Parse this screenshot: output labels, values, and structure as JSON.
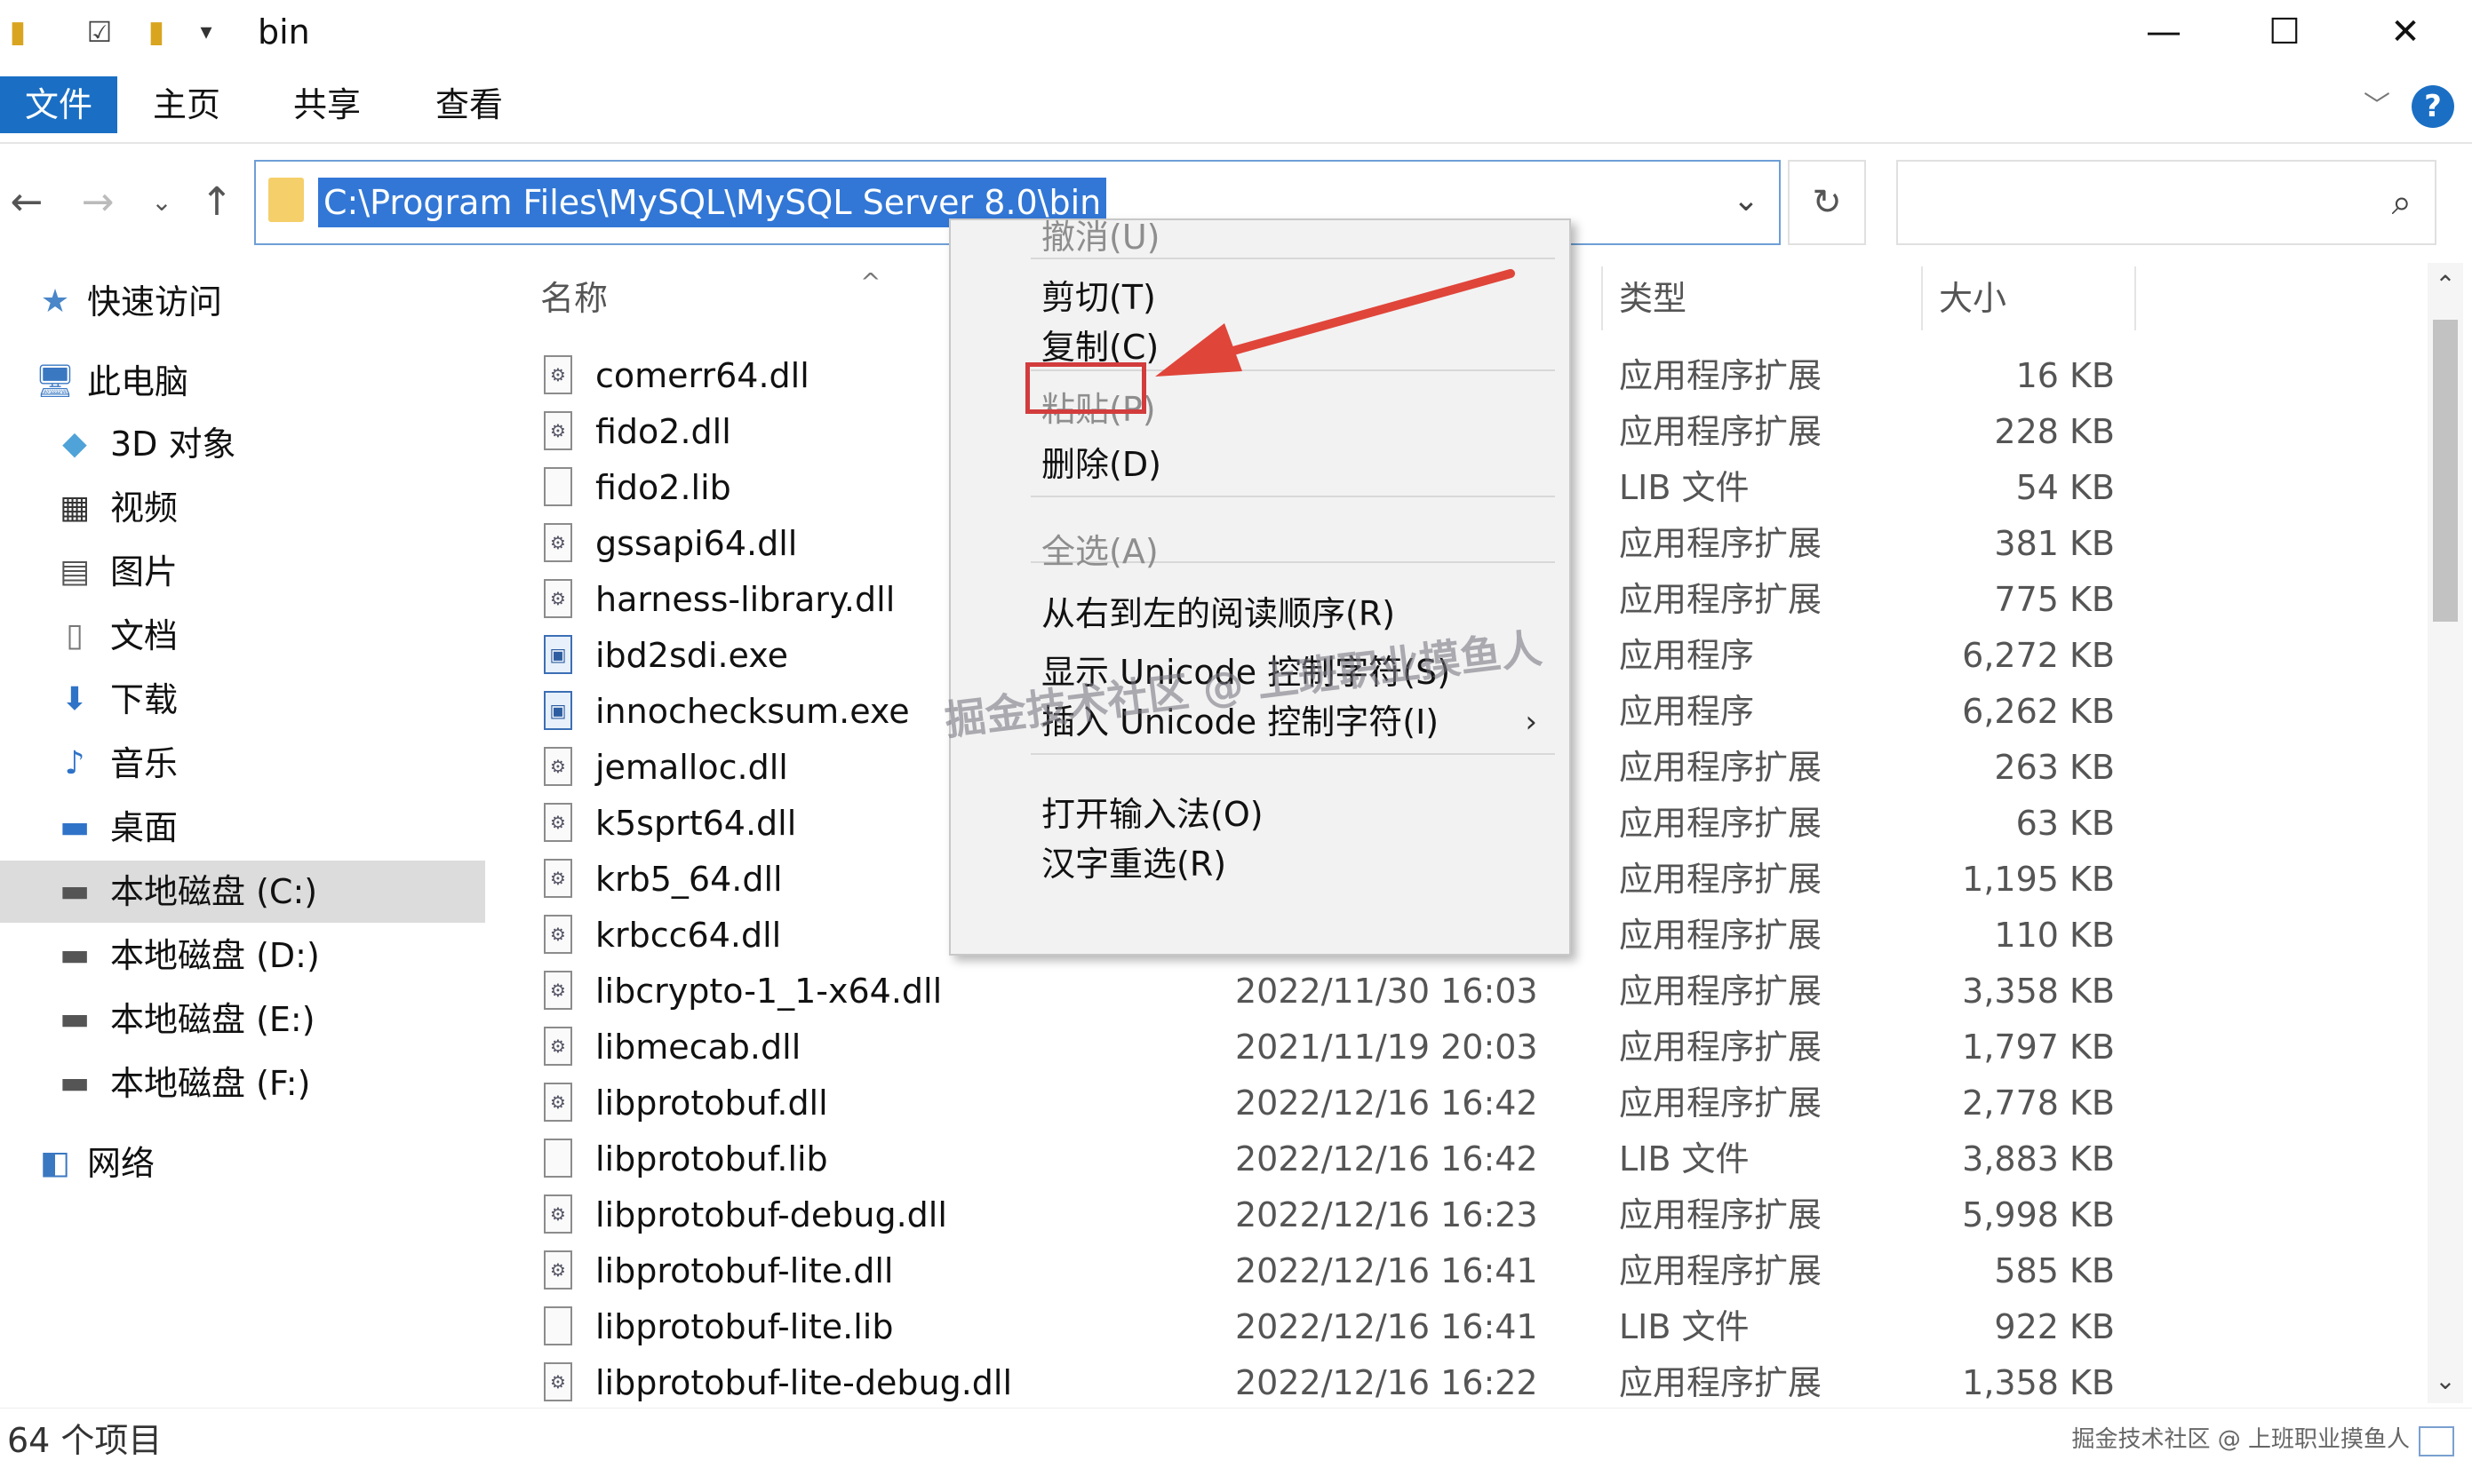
{
  "window": {
    "title": "bin",
    "minimize": "—",
    "maximize": "☐",
    "close": "✕"
  },
  "ribbon": {
    "tabs": [
      "文件",
      "主页",
      "共享",
      "查看"
    ],
    "help": "?"
  },
  "address": {
    "path": "C:\\Program Files\\MySQL\\MySQL Server 8.0\\bin"
  },
  "nav_pane": {
    "items": [
      {
        "label": "快速访问",
        "icon": "star-icon"
      },
      {
        "label": "此电脑",
        "icon": "computer-icon"
      },
      {
        "label": "3D 对象",
        "icon": "cube-icon"
      },
      {
        "label": "视频",
        "icon": "film-icon"
      },
      {
        "label": "图片",
        "icon": "picture-icon"
      },
      {
        "label": "文档",
        "icon": "document-icon"
      },
      {
        "label": "下载",
        "icon": "download-icon"
      },
      {
        "label": "音乐",
        "icon": "music-icon"
      },
      {
        "label": "桌面",
        "icon": "desktop-icon"
      },
      {
        "label": "本地磁盘 (C:)",
        "icon": "drive-icon",
        "selected": true
      },
      {
        "label": "本地磁盘 (D:)",
        "icon": "drive-icon"
      },
      {
        "label": "本地磁盘 (E:)",
        "icon": "drive-icon"
      },
      {
        "label": "本地磁盘 (F:)",
        "icon": "drive-icon"
      },
      {
        "label": "网络",
        "icon": "network-icon"
      }
    ]
  },
  "file_list": {
    "columns": {
      "name": "名称",
      "type": "类型",
      "size": "大小"
    },
    "rows": [
      {
        "name": "comerr64.dll",
        "date": "",
        "type": "应用程序扩展",
        "size": "16 KB",
        "kind": "dll"
      },
      {
        "name": "fido2.dll",
        "date": "",
        "type": "应用程序扩展",
        "size": "228 KB",
        "kind": "dll"
      },
      {
        "name": "fido2.lib",
        "date": "",
        "type": "LIB 文件",
        "size": "54 KB",
        "kind": "lib"
      },
      {
        "name": "gssapi64.dll",
        "date": "",
        "type": "应用程序扩展",
        "size": "381 KB",
        "kind": "dll"
      },
      {
        "name": "harness-library.dll",
        "date": "",
        "type": "应用程序扩展",
        "size": "775 KB",
        "kind": "dll"
      },
      {
        "name": "ibd2sdi.exe",
        "date": "",
        "type": "应用程序",
        "size": "6,272 KB",
        "kind": "exe"
      },
      {
        "name": "innochecksum.exe",
        "date": "",
        "type": "应用程序",
        "size": "6,262 KB",
        "kind": "exe"
      },
      {
        "name": "jemalloc.dll",
        "date": "",
        "type": "应用程序扩展",
        "size": "263 KB",
        "kind": "dll"
      },
      {
        "name": "k5sprt64.dll",
        "date": "",
        "type": "应用程序扩展",
        "size": "63 KB",
        "kind": "dll"
      },
      {
        "name": "krb5_64.dll",
        "date": "",
        "type": "应用程序扩展",
        "size": "1,195 KB",
        "kind": "dll"
      },
      {
        "name": "krbcc64.dll",
        "date": "",
        "type": "应用程序扩展",
        "size": "110 KB",
        "kind": "dll"
      },
      {
        "name": "libcrypto-1_1-x64.dll",
        "date": "2022/11/30 16:03",
        "type": "应用程序扩展",
        "size": "3,358 KB",
        "kind": "dll"
      },
      {
        "name": "libmecab.dll",
        "date": "2021/11/19 20:03",
        "type": "应用程序扩展",
        "size": "1,797 KB",
        "kind": "dll"
      },
      {
        "name": "libprotobuf.dll",
        "date": "2022/12/16 16:42",
        "type": "应用程序扩展",
        "size": "2,778 KB",
        "kind": "dll"
      },
      {
        "name": "libprotobuf.lib",
        "date": "2022/12/16 16:42",
        "type": "LIB 文件",
        "size": "3,883 KB",
        "kind": "lib"
      },
      {
        "name": "libprotobuf-debug.dll",
        "date": "2022/12/16 16:23",
        "type": "应用程序扩展",
        "size": "5,998 KB",
        "kind": "dll"
      },
      {
        "name": "libprotobuf-lite.dll",
        "date": "2022/12/16 16:41",
        "type": "应用程序扩展",
        "size": "585 KB",
        "kind": "dll"
      },
      {
        "name": "libprotobuf-lite.lib",
        "date": "2022/12/16 16:41",
        "type": "LIB 文件",
        "size": "922 KB",
        "kind": "lib"
      },
      {
        "name": "libprotobuf-lite-debug.dll",
        "date": "2022/12/16 16:22",
        "type": "应用程序扩展",
        "size": "1,358 KB",
        "kind": "dll"
      }
    ]
  },
  "context_menu": {
    "items": [
      {
        "label": "撤消(U)",
        "disabled": true
      },
      {
        "label": "剪切(T)"
      },
      {
        "label": "复制(C)",
        "highlighted": true
      },
      {
        "label": "粘贴(P)",
        "disabled": true
      },
      {
        "label": "删除(D)"
      },
      {
        "label": "全选(A)",
        "disabled": true
      },
      {
        "label": "从右到左的阅读顺序(R)"
      },
      {
        "label": "显示 Unicode 控制字符(S)"
      },
      {
        "label": "插入 Unicode 控制字符(I)",
        "submenu": true
      },
      {
        "label": "打开输入法(O)"
      },
      {
        "label": "汉字重选(R)"
      }
    ]
  },
  "status": {
    "item_count": "64 个项目"
  },
  "watermarks": {
    "center": "掘金技术社区 @ 上班职业摸鱼人",
    "corner": "掘金技术社区 @ 上班职业摸鱼人"
  },
  "colors": {
    "accent": "#1a6fc4",
    "selection": "#3277d6",
    "highlight_box": "#d23c3c",
    "arrow": "#e0453a"
  }
}
